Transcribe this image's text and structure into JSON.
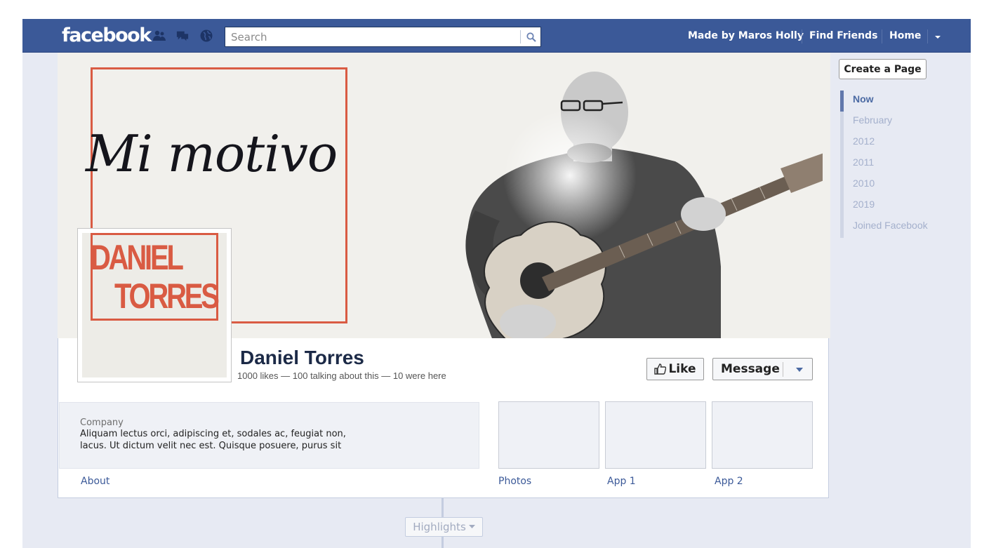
{
  "topbar": {
    "logo": "facebook",
    "search_placeholder": "Search",
    "nav": {
      "made_by": "Made by Maros Holly",
      "find_friends": "Find Friends",
      "home": "Home"
    },
    "colors": {
      "bar": "#3b5998"
    }
  },
  "cover": {
    "script_text": "Mi motivo",
    "profile_name_line1": "DANIEL",
    "profile_name_line2": "TORRES",
    "accent_color": "#d95b43"
  },
  "page": {
    "name": "Daniel Torres",
    "stats": "1000 likes — 100 talking about this — 10 were here",
    "like_label": "Like",
    "message_label": "Message"
  },
  "about": {
    "category": "Company",
    "description": "Aliquam lectus orci, adipiscing et, sodales ac, feugiat non, lacus. Ut dictum velit nec est. Quisque posuere, purus sit"
  },
  "tabs": [
    "About",
    "Photos",
    "App 1",
    "App 2"
  ],
  "right_rail": {
    "create_page_label": "Create a Page",
    "timeline": [
      "Now",
      "February",
      "2012",
      "2011",
      "2010",
      "2019",
      "Joined Facebook"
    ],
    "active_index": 0
  },
  "highlights_label": "Highlights"
}
